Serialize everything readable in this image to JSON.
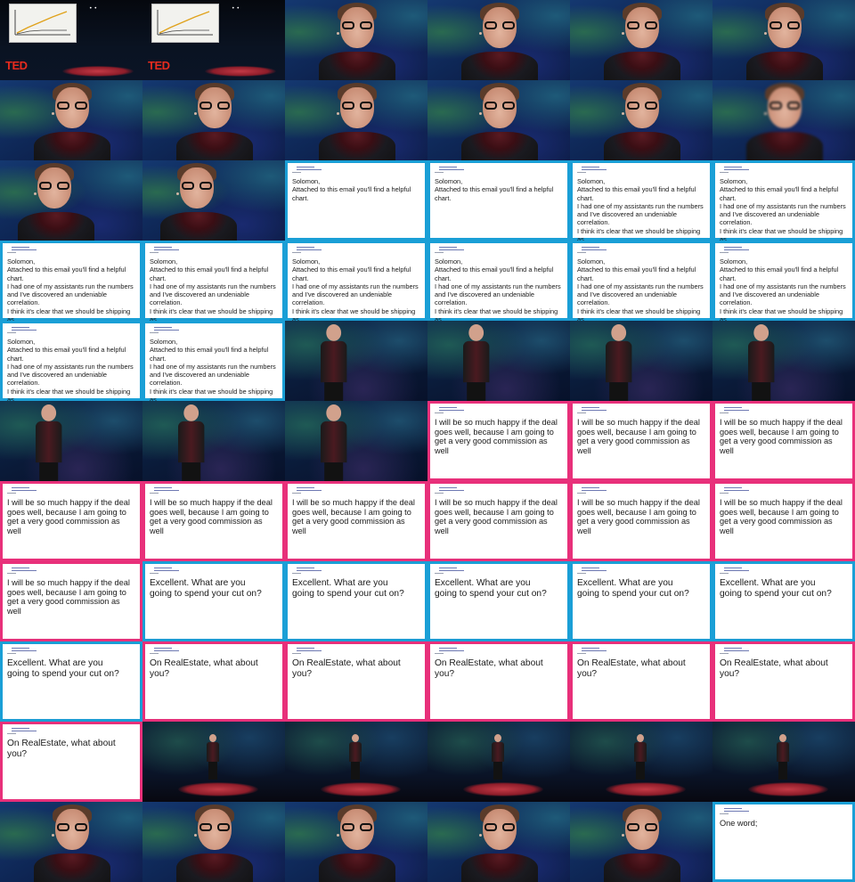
{
  "intro": {
    "logo": "TED"
  },
  "email_texts": {
    "solomon_short": "Solomon,\nAttached to this email you'll find a helpful\nchart.",
    "solomon_long": "Solomon,\nAttached to this email you'll find a helpful\nchart.\nI had one of my assistants run the numbers\nand I've discovered an undeniable correlation.\nI think it's clear that we should be shipping as\nmuch gold as possible.",
    "commission": "I will be so much happy if the deal\ngoes well, because I am going to\nget a very good commission as\nwell",
    "excellent": "Excellent. What are you\ngoing to spend your cut on?",
    "realestate": "On RealEstate, what about\nyou?",
    "one_word": "One word;"
  },
  "cells": [
    {
      "kind": "intro"
    },
    {
      "kind": "intro"
    },
    {
      "kind": "closeup"
    },
    {
      "kind": "closeup"
    },
    {
      "kind": "closeup"
    },
    {
      "kind": "closeup"
    },
    {
      "kind": "closeup"
    },
    {
      "kind": "closeup"
    },
    {
      "kind": "closeup"
    },
    {
      "kind": "closeup"
    },
    {
      "kind": "closeup"
    },
    {
      "kind": "closeup-blur"
    },
    {
      "kind": "closeup-offset"
    },
    {
      "kind": "closeup-offset"
    },
    {
      "kind": "email",
      "text": "solomon_short",
      "border": "blue",
      "size": "small"
    },
    {
      "kind": "email",
      "text": "solomon_short",
      "border": "blue",
      "size": "small"
    },
    {
      "kind": "email",
      "text": "solomon_long",
      "border": "blue",
      "size": "small"
    },
    {
      "kind": "email",
      "text": "solomon_long",
      "border": "blue",
      "size": "small"
    },
    {
      "kind": "email",
      "text": "solomon_long",
      "border": "blue",
      "size": "small"
    },
    {
      "kind": "email",
      "text": "solomon_long",
      "border": "blue",
      "size": "small"
    },
    {
      "kind": "email",
      "text": "solomon_long",
      "border": "blue",
      "size": "small"
    },
    {
      "kind": "email",
      "text": "solomon_long",
      "border": "blue",
      "size": "small"
    },
    {
      "kind": "email",
      "text": "solomon_long",
      "border": "blue",
      "size": "small"
    },
    {
      "kind": "email",
      "text": "solomon_long",
      "border": "blue",
      "size": "small"
    },
    {
      "kind": "email",
      "text": "solomon_long",
      "border": "blue",
      "size": "small"
    },
    {
      "kind": "email",
      "text": "solomon_long",
      "border": "blue",
      "size": "small"
    },
    {
      "kind": "mid"
    },
    {
      "kind": "mid"
    },
    {
      "kind": "mid"
    },
    {
      "kind": "mid"
    },
    {
      "kind": "mid"
    },
    {
      "kind": "mid"
    },
    {
      "kind": "mid"
    },
    {
      "kind": "email",
      "text": "commission",
      "border": "pink",
      "size": "medium"
    },
    {
      "kind": "email",
      "text": "commission",
      "border": "pink",
      "size": "medium"
    },
    {
      "kind": "email",
      "text": "commission",
      "border": "pink",
      "size": "medium"
    },
    {
      "kind": "email",
      "text": "commission",
      "border": "pink",
      "size": "medium"
    },
    {
      "kind": "email",
      "text": "commission",
      "border": "pink",
      "size": "medium"
    },
    {
      "kind": "email",
      "text": "commission",
      "border": "pink",
      "size": "medium"
    },
    {
      "kind": "email",
      "text": "commission",
      "border": "pink",
      "size": "medium"
    },
    {
      "kind": "email",
      "text": "commission",
      "border": "pink",
      "size": "medium"
    },
    {
      "kind": "email",
      "text": "commission",
      "border": "pink",
      "size": "medium"
    },
    {
      "kind": "email",
      "text": "commission",
      "border": "pink",
      "size": "medium"
    },
    {
      "kind": "email",
      "text": "excellent",
      "border": "blue",
      "size": "large"
    },
    {
      "kind": "email",
      "text": "excellent",
      "border": "blue",
      "size": "large"
    },
    {
      "kind": "email",
      "text": "excellent",
      "border": "blue",
      "size": "large"
    },
    {
      "kind": "email",
      "text": "excellent",
      "border": "blue",
      "size": "large"
    },
    {
      "kind": "email",
      "text": "excellent",
      "border": "blue",
      "size": "large"
    },
    {
      "kind": "email",
      "text": "excellent",
      "border": "blue",
      "size": "large"
    },
    {
      "kind": "email",
      "text": "realestate",
      "border": "pink",
      "size": "large"
    },
    {
      "kind": "email",
      "text": "realestate",
      "border": "pink",
      "size": "large"
    },
    {
      "kind": "email",
      "text": "realestate",
      "border": "pink",
      "size": "large"
    },
    {
      "kind": "email",
      "text": "realestate",
      "border": "pink",
      "size": "large"
    },
    {
      "kind": "email",
      "text": "realestate",
      "border": "pink",
      "size": "large"
    },
    {
      "kind": "email",
      "text": "realestate",
      "border": "pink",
      "size": "large"
    },
    {
      "kind": "stage"
    },
    {
      "kind": "stage"
    },
    {
      "kind": "stage"
    },
    {
      "kind": "stage"
    },
    {
      "kind": "stage"
    },
    {
      "kind": "closeup"
    },
    {
      "kind": "closeup"
    },
    {
      "kind": "closeup"
    },
    {
      "kind": "closeup"
    },
    {
      "kind": "closeup"
    },
    {
      "kind": "email",
      "text": "one_word",
      "border": "blue",
      "size": "medium"
    }
  ],
  "colors": {
    "blue_border": "#1a9fd6",
    "pink_border": "#e8307a"
  }
}
